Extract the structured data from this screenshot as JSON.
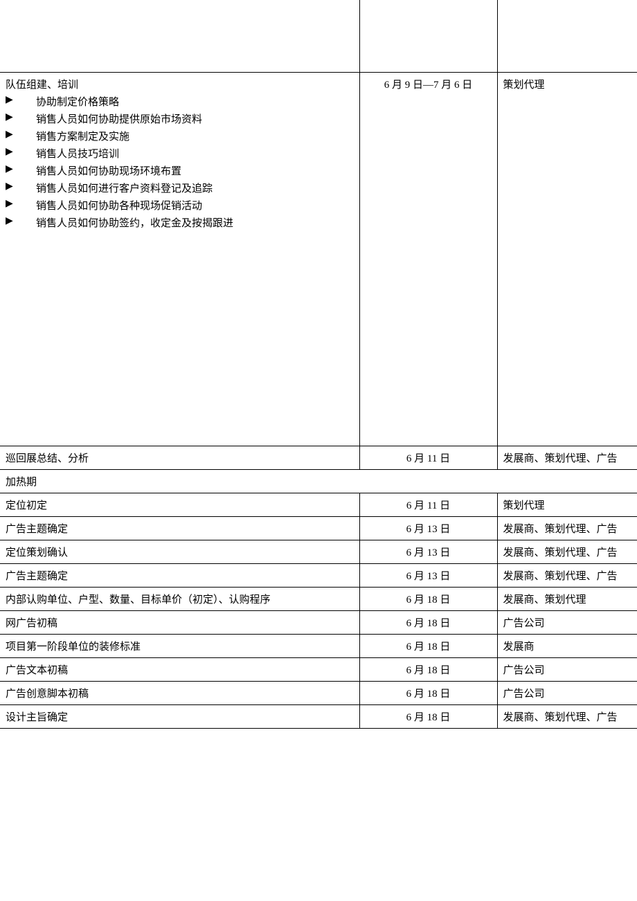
{
  "rows": {
    "spacer_date": "",
    "spacer_resp": "",
    "training": {
      "title": "队伍组建、培训",
      "bullets": [
        "协助制定价格策略",
        "销售人员如何协助提供原始市场资料",
        "销售方案制定及实施",
        "销售人员技巧培训",
        "销售人员如何协助现场环境布置",
        "销售人员如何进行客户资料登记及追踪",
        "销售人员如何协助各种现场促销活动",
        "销售人员如何协助签约，收定金及按揭跟进"
      ],
      "date": "6 月 9 日—7 月 6 日",
      "resp": "策划代理"
    },
    "tour": {
      "task": "巡回展总结、分析",
      "date": "6 月 11 日",
      "resp": "发展商、策划代理、广告"
    },
    "section_heat": "加热期",
    "items": [
      {
        "task": "定位初定",
        "date": "6 月 11 日",
        "resp": "策划代理"
      },
      {
        "task": "广告主题确定",
        "date": "6 月 13 日",
        "resp": "发展商、策划代理、广告"
      },
      {
        "task": "定位策划确认",
        "date": "6 月 13 日",
        "resp": "发展商、策划代理、广告"
      },
      {
        "task": "广告主题确定",
        "date": "6 月 13 日",
        "resp": "发展商、策划代理、广告"
      },
      {
        "task": "内部认购单位、户型、数量、目标单价（初定）、认购程序",
        "date": "6 月 18 日",
        "resp": "发展商、策划代理"
      },
      {
        "task": "网广告初稿",
        "date": "6 月 18 日",
        "resp": "广告公司"
      },
      {
        "task": "项目第一阶段单位的装修标准",
        "date": "6 月 18 日",
        "resp": "发展商"
      },
      {
        "task": "广告文本初稿",
        "date": "6 月 18 日",
        "resp": "广告公司"
      },
      {
        "task": "广告创意脚本初稿",
        "date": "6 月 18 日",
        "resp": "广告公司"
      },
      {
        "task": "设计主旨确定",
        "date": "6 月 18 日",
        "resp": "发展商、策划代理、广告"
      }
    ]
  }
}
